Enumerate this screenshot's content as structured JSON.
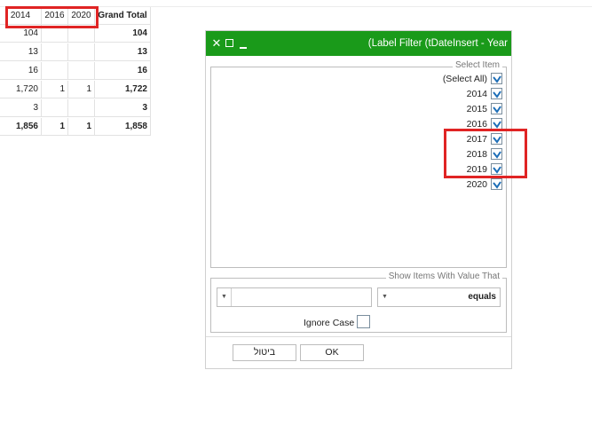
{
  "pivot": {
    "headers": [
      "2014",
      "2016",
      "2020",
      "Grand Total"
    ],
    "rows": [
      [
        "104",
        "",
        "",
        "104"
      ],
      [
        "13",
        "",
        "",
        "13"
      ],
      [
        "16",
        "",
        "",
        "16"
      ],
      [
        "1,720",
        "1",
        "1",
        "1,722"
      ],
      [
        "3",
        "",
        "",
        "3"
      ]
    ],
    "totals": [
      "1,856",
      "1",
      "1",
      "1,858"
    ]
  },
  "dialog": {
    "title": "(Label Filter (tDateInsert - Year",
    "select_legend": "Select Item",
    "items": [
      {
        "label": "(Select All)",
        "checked": true
      },
      {
        "label": "2014",
        "checked": true
      },
      {
        "label": "2015",
        "checked": true
      },
      {
        "label": "2016",
        "checked": true
      },
      {
        "label": "2017",
        "checked": true
      },
      {
        "label": "2018",
        "checked": true
      },
      {
        "label": "2019",
        "checked": true
      },
      {
        "label": "2020",
        "checked": true
      }
    ],
    "show_legend": "Show Items With Value That",
    "value_input": "",
    "operator": "equals",
    "ignore_case_label": "Ignore Case",
    "cancel_label": "ביטול",
    "ok_label": "OK"
  },
  "colors": {
    "titlebar": "#1a9a1a",
    "highlight": "#e02424",
    "check": "#1e6fb8"
  }
}
